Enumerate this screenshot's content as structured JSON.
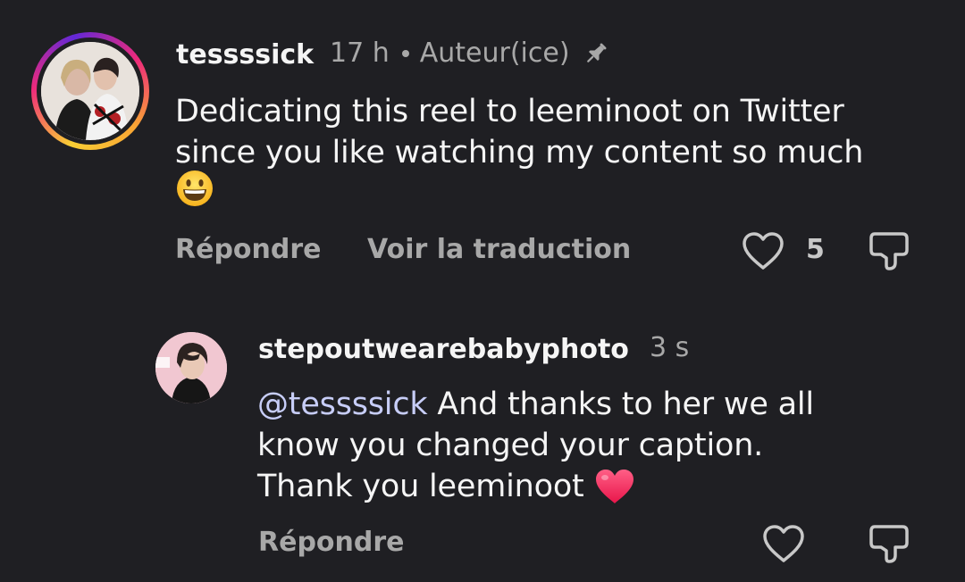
{
  "comments": [
    {
      "username": "tessssick",
      "time": "17 h",
      "author_badge": "Auteur(ice)",
      "text_line1": "Dedicating this reel to leeminoot on Twitter",
      "text_line2": "since you like watching my content so much",
      "emoji": "grinning-face",
      "reply_label": "Répondre",
      "translate_label": "Voir la traduction",
      "like_count": "5",
      "pinned": true
    },
    {
      "username": "stepoutwearebabyphoto",
      "time": "3 s",
      "mention": "@tessssick",
      "text_line1_rest": " And thanks to her we all",
      "text_line2": "know you changed your caption.",
      "text_line3": "Thank you leeminoot ",
      "emoji": "red-heart",
      "reply_label": "Répondre"
    }
  ],
  "colors": {
    "background": "#1f1f23",
    "primary_text": "#f5f5f5",
    "secondary_text": "#a8a8a8",
    "mention": "#c7cdf7"
  }
}
